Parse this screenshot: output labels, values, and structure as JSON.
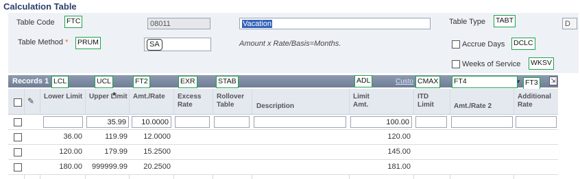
{
  "page": {
    "title": "Calculation Table"
  },
  "form": {
    "table_code_label": "Table Code",
    "table_code_tag": "FTC",
    "code_value": "08011",
    "description_value": "Vacation",
    "table_type_label": "Table Type",
    "table_type_tag": "TABT",
    "table_type_value": "D",
    "table_method_label": "Table Method",
    "required_marker": "*",
    "table_method_tag": "PRUM",
    "method_value": "SA",
    "formula_text": "Amount x Rate/Basis=Months.",
    "accrue_days_label": "Accrue Days",
    "accrue_days_tag": "DCLC",
    "weeks_service_label": "Weeks of Service",
    "weeks_service_tag": "WKSV"
  },
  "grid": {
    "records_label": "Records 1",
    "customize_link": "Custo",
    "tags": {
      "lcl": "LCL",
      "ucl": "UCL",
      "ft2": "FT2",
      "exr": "EXR",
      "stab": "STAB",
      "adl": "ADL",
      "cmax": "CMAX",
      "ft4": "FT4",
      "ft3": "FT3"
    },
    "columns": {
      "lower": "Lower Limit",
      "upper": "Upper Limit",
      "upper_marker": "*",
      "amt_rate": "Amt./Rate",
      "excess": "Excess Rate",
      "rollover": "Rollover Table",
      "description": "Description",
      "limit_amt": "Limit Amt.",
      "itd": "ITD Limit",
      "amt_rate2": "Amt./Rate 2",
      "additional": "Additional Rate"
    },
    "input_row": {
      "upper": "35.99",
      "amt_rate": "10.0000",
      "limit_amt": "100.00"
    },
    "rows": [
      {
        "lower": "36.00",
        "upper": "119.99",
        "amt_rate": "12.0000",
        "limit_amt": "120.00"
      },
      {
        "lower": "120.00",
        "upper": "179.99",
        "amt_rate": "15.2500",
        "limit_amt": "145.00"
      },
      {
        "lower": "180.00",
        "upper": "999999.99",
        "amt_rate": "20.2500",
        "limit_amt": "181.00"
      }
    ]
  },
  "colors": {
    "accent": "#2b3f6b",
    "tag_border": "#1aa34a",
    "header_bg": "#7a889f",
    "required": "#e8650f"
  }
}
